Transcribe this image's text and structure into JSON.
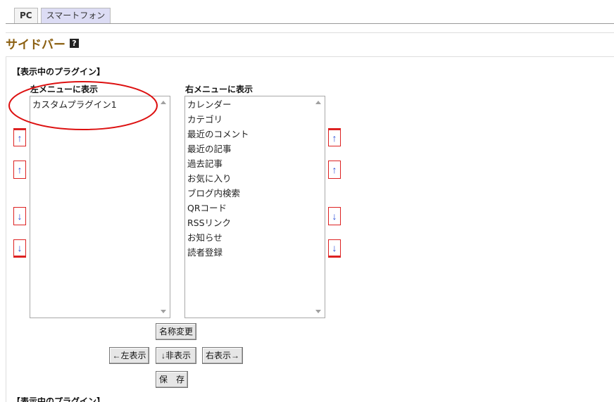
{
  "tabs": [
    {
      "label": "PC"
    },
    {
      "label": "スマートフォン"
    }
  ],
  "section": {
    "title": "サイドバー",
    "help_icon": "?"
  },
  "group_label": "【表示中のプラグイン】",
  "left_list": {
    "title": "左メニューに表示",
    "items": [
      "カスタムプラグイン1"
    ]
  },
  "right_list": {
    "title": "右メニューに表示",
    "items": [
      "カレンダー",
      "カテゴリ",
      "最近のコメント",
      "最近の記事",
      "過去記事",
      "お気に入り",
      "ブログ内検索",
      "QRコード",
      "RSSリンク",
      "お知らせ",
      "読者登録"
    ]
  },
  "move_buttons": {
    "top": "↑",
    "up": "↑",
    "down": "↓",
    "bottom": "↓"
  },
  "actions": {
    "rename": "名称変更",
    "show_left": "←左表示",
    "hide": "↓非表示",
    "show_right": "右表示→",
    "save": "保　存"
  },
  "footer_peek": "【表示中のプラグイン】",
  "colors": {
    "title": "#8b5f10",
    "annotation": "#dd1111",
    "move_arrow": "#2b4fd8"
  }
}
